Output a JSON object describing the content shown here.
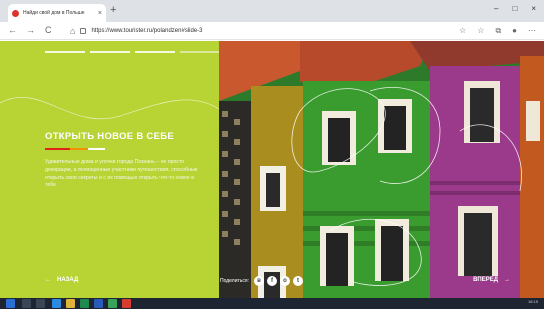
{
  "browser": {
    "tab_title": "Найди свой дом в Польше",
    "tab_close": "×",
    "new_tab": "+",
    "url": "https://www.tourister.ru/polandzen#slide-3",
    "win_min": "–",
    "win_max": "□",
    "win_close": "×",
    "back_glyph": "←",
    "forward_glyph": "→",
    "reload_glyph": "C",
    "home_glyph": "⌂",
    "toolbar_icons": [
      "☆",
      "☆",
      "⧉",
      "●",
      "⋯"
    ]
  },
  "slide": {
    "headline": "ОТКРЫТЬ НОВОЕ В СЕБЕ",
    "body": "Удивительные дома и улочки города Познань – не просто декорации, а полноценные участники путешествия, способные открыть свои секреты и с их помощью открыть что-то новое в тебе",
    "back_label": "НАЗАД",
    "back_arrow": "←",
    "forward_label": "ВПЕРЕД",
    "forward_arrow": "→",
    "share_label": "Поделиться:",
    "share_icons": [
      "vk-icon",
      "facebook-icon",
      "odnoklassniki-icon",
      "twitter-icon"
    ],
    "share_glyphs": [
      "в",
      "f",
      "о",
      "t"
    ],
    "progress_segments": 4,
    "active_slide": 3
  },
  "taskbar": {
    "clock": "16:19"
  },
  "colors": {
    "panel_green": "#b7d334",
    "accent_red": "#e2231a",
    "accent_orange": "#f39200",
    "accent_white": "#ffffff"
  }
}
